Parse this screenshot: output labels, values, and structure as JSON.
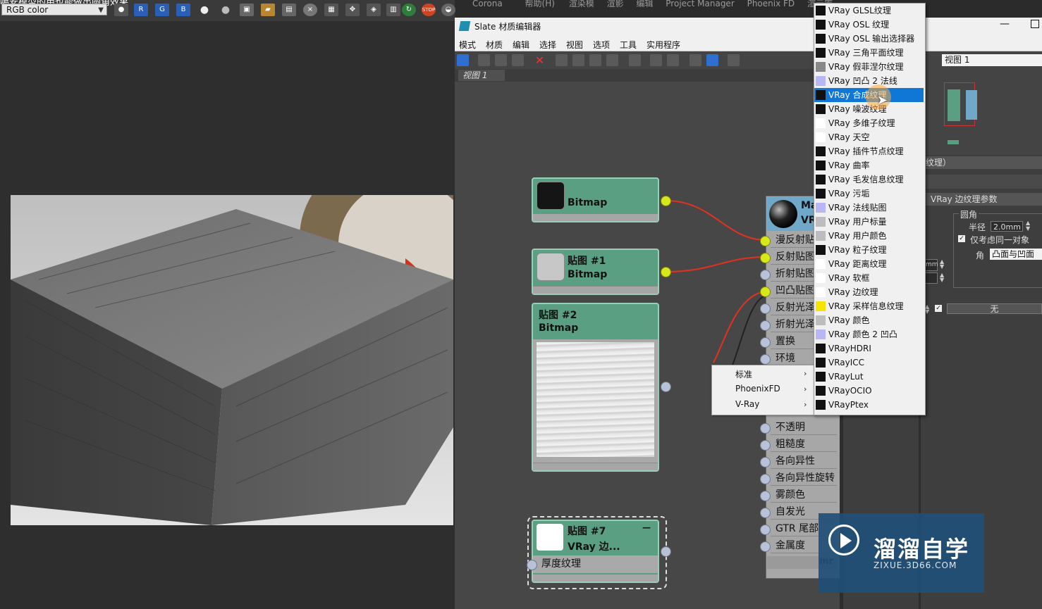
{
  "left_window": {
    "title": "噶安模型的用也能做出圆角效果",
    "channel_select": "RGB color",
    "toolbar_channels": [
      "R",
      "G",
      "B"
    ]
  },
  "bg_menu": [
    "Corona",
    "帮助(H)",
    "渲染模",
    "渲影",
    "编辑",
    "Project Manager",
    "Phoenix FD",
    "渲云库"
  ],
  "slate": {
    "title": "Slate 材质编辑器",
    "menu": [
      "模式",
      "材质",
      "编辑",
      "选择",
      "视图",
      "选项",
      "工具",
      "实用程序"
    ],
    "view_tab": "视图 1",
    "view_field": "视图 1"
  },
  "nodes": {
    "node1": {
      "title": "Bitmap"
    },
    "node2": {
      "title": "贴图 #1",
      "type": "Bitmap"
    },
    "node3": {
      "title": "贴图 #2",
      "type": "Bitmap"
    },
    "node4": {
      "title": "贴图 #7",
      "type": "VRay 边...",
      "slot": "厚度纹理"
    }
  },
  "material_node": {
    "title_a": "Ma",
    "title_b": "VR",
    "slots": [
      "漫反射贴",
      "反射贴图",
      "折射贴图",
      "凹凸贴图",
      "反射光泽",
      "折射光泽",
      "置换",
      "环境"
    ],
    "slots_lower": [
      "不透明",
      "粗糙度",
      "各向异性",
      "各向异性旋转",
      "雾颜色",
      "自发光",
      "GTR 尾部",
      "金属度"
    ],
    "footer": "mr"
  },
  "context_menu": {
    "items": [
      "标准",
      "PhoenixFD",
      "V-Ray"
    ]
  },
  "dropdown": {
    "items": [
      {
        "label": "VRay GLSL纹理",
        "swatch": "#111111"
      },
      {
        "label": "VRay OSL 纹理",
        "swatch": "#111111"
      },
      {
        "label": "VRay OSL 输出选择器",
        "swatch": "#111111"
      },
      {
        "label": "VRay 三角平面纹理",
        "swatch": "#111111"
      },
      {
        "label": "VRay 假菲涅尔纹理",
        "swatch": "#888888"
      },
      {
        "label": "VRay 凹凸 2 法线",
        "swatch": "#b7b7f5"
      },
      {
        "label": "VRay 合成纹理",
        "swatch": "#111111",
        "selected": true
      },
      {
        "label": "VRay 噪波纹理",
        "swatch": "#111111"
      },
      {
        "label": "VRay 多维子纹理",
        "swatch": "#ffffff"
      },
      {
        "label": "VRay 天空",
        "swatch": "#ffffff"
      },
      {
        "label": "VRay 插件节点纹理",
        "swatch": "#111111"
      },
      {
        "label": "VRay 曲率",
        "swatch": "#111111"
      },
      {
        "label": "VRay 毛发信息纹理",
        "swatch": "#111111"
      },
      {
        "label": "VRay 污垢",
        "swatch": "#111111"
      },
      {
        "label": "VRay 法线贴图",
        "swatch": "#b7b7f5"
      },
      {
        "label": "VRay 用户标量",
        "swatch": "#bdbdbd"
      },
      {
        "label": "VRay 用户颜色",
        "swatch": "#bdbdbd"
      },
      {
        "label": "VRay 粒子纹理",
        "swatch": "#111111"
      },
      {
        "label": "VRay 距离纹理",
        "swatch": "#ffffff"
      },
      {
        "label": "VRay 软框",
        "swatch": "#ffffff"
      },
      {
        "label": "VRay 边纹理",
        "swatch": "#ffffff"
      },
      {
        "label": "VRay 采样信息纹理",
        "swatch": "#f2e600"
      },
      {
        "label": "VRay 颜色",
        "swatch": "#bdbdbd"
      },
      {
        "label": "VRay 颜色 2 凹凸",
        "swatch": "#b7b7f5"
      },
      {
        "label": "VRayHDRI",
        "swatch": "#111111"
      },
      {
        "label": "VRayICC",
        "swatch": "#111111"
      },
      {
        "label": "VRayLut",
        "swatch": "#111111"
      },
      {
        "label": "VRayOCIO",
        "swatch": "#111111"
      },
      {
        "label": "VRayPtex",
        "swatch": "#111111"
      }
    ]
  },
  "right_panel": {
    "section_title": "纹理）",
    "params_title": "VRay 边纹理参数",
    "group_label": "圆角",
    "radius_label": "半径",
    "radius_value": "2.0mm",
    "same_object_label": "仅考虑同一对象",
    "corner_label": "角",
    "corner_value": "凸面与凹面",
    "none_button": "无",
    "small_value": "mm"
  },
  "watermark": {
    "name": "溜溜自学",
    "url": "ZIXUE.3D66.COM"
  }
}
